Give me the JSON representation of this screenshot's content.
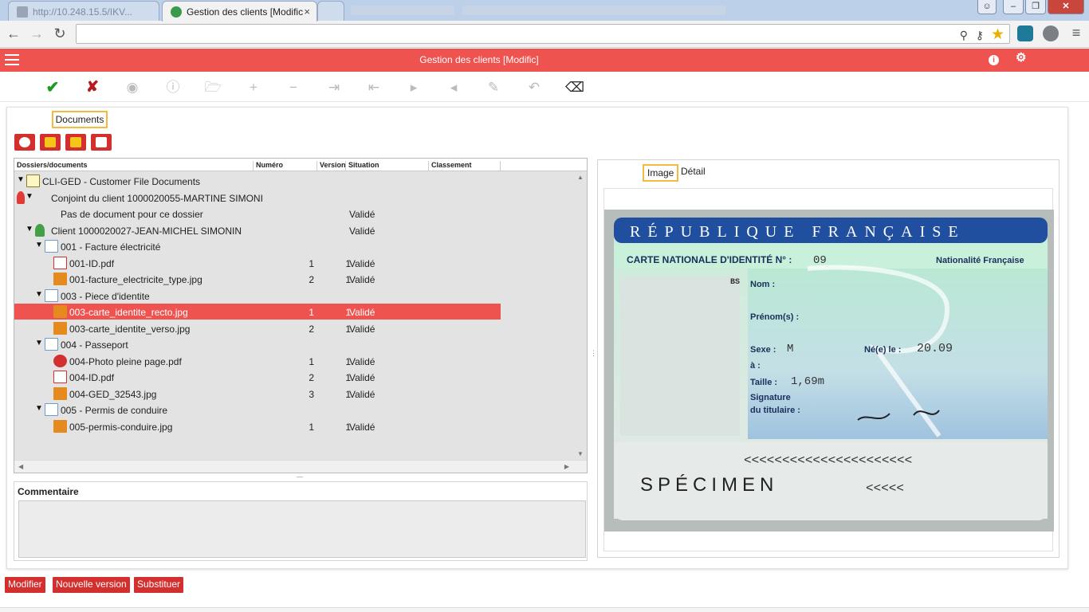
{
  "browser": {
    "tabs": [
      {
        "label": "http://10.248.15.5/IKV..."
      },
      {
        "label": "Gestion des clients [Modific"
      },
      {
        "label": ""
      }
    ],
    "window_controls": [
      "minimize",
      "maximize",
      "close"
    ]
  },
  "app": {
    "title": "Gestion des clients [Modific]",
    "accent_color": "#ef5350"
  },
  "toolbar": {
    "tools": [
      "check-icon",
      "cross-icon",
      "binoculars-icon",
      "info-icon",
      "folder-icon",
      "plus-icon",
      "minus-icon",
      "last-icon",
      "first-icon",
      "next-icon",
      "previous-icon",
      "pencil-icon",
      "undo-icon",
      "eraser-icon"
    ]
  },
  "documents_panel": {
    "tab_label": "Documents",
    "columns": [
      "Dossiers/documents",
      "Numéro",
      "Version",
      "Situation",
      "Classement"
    ],
    "rows": [
      {
        "level": 0,
        "toggle": "▼",
        "icon": "folder",
        "label": "CLI-GED - Customer File Documents",
        "num": "",
        "ver": "",
        "sit": ""
      },
      {
        "level": 1,
        "toggle": "▼",
        "icon": "person-red",
        "label": "Conjoint du client 1000020055-MARTINE SIMONI",
        "num": "",
        "ver": "",
        "sit": ""
      },
      {
        "level": 3,
        "toggle": "",
        "icon": "",
        "label": "Pas de document pour ce dossier",
        "num": "",
        "ver": "",
        "sit": "Validé"
      },
      {
        "level": 1,
        "toggle": "▼",
        "icon": "person-green",
        "label": "Client 1000020027-JEAN-MICHEL SIMONIN",
        "num": "",
        "ver": "",
        "sit": "Validé"
      },
      {
        "level": 2,
        "toggle": "▼",
        "icon": "doc-arrow",
        "label": "001 - Facture électricité",
        "num": "",
        "ver": "",
        "sit": ""
      },
      {
        "level": 3,
        "toggle": "",
        "icon": "pdf",
        "label": "001-ID.pdf",
        "num": "1",
        "ver": "1",
        "sit": "Validé"
      },
      {
        "level": 3,
        "toggle": "",
        "icon": "img",
        "label": "001-facture_electricite_type.jpg",
        "num": "2",
        "ver": "1",
        "sit": "Validé"
      },
      {
        "level": 2,
        "toggle": "▼",
        "icon": "doc-arrow",
        "label": "003 - Piece d'identite",
        "num": "",
        "ver": "",
        "sit": ""
      },
      {
        "level": 3,
        "toggle": "",
        "icon": "img",
        "label": "003-carte_identite_recto.jpg",
        "num": "1",
        "ver": "1",
        "sit": "Validé",
        "selected": true
      },
      {
        "level": 3,
        "toggle": "",
        "icon": "img",
        "label": "003-carte_identite_verso.jpg",
        "num": "2",
        "ver": "1",
        "sit": "Validé"
      },
      {
        "level": 2,
        "toggle": "▼",
        "icon": "doc-arrow",
        "label": "004 - Passeport",
        "num": "",
        "ver": "",
        "sit": ""
      },
      {
        "level": 3,
        "toggle": "",
        "icon": "error",
        "label": "004-Photo pleine page.pdf",
        "num": "1",
        "ver": "1",
        "sit": "Validé"
      },
      {
        "level": 3,
        "toggle": "",
        "icon": "pdf",
        "label": "004-ID.pdf",
        "num": "2",
        "ver": "1",
        "sit": "Validé"
      },
      {
        "level": 3,
        "toggle": "",
        "icon": "img",
        "label": "004-GED_32543.jpg",
        "num": "3",
        "ver": "1",
        "sit": "Validé"
      },
      {
        "level": 2,
        "toggle": "▼",
        "icon": "doc-arrow",
        "label": "005 - Permis de conduire",
        "num": "",
        "ver": "",
        "sit": ""
      },
      {
        "level": 3,
        "toggle": "",
        "icon": "img",
        "label": "005-permis-conduire.jpg",
        "num": "1",
        "ver": "1",
        "sit": "Validé"
      }
    ]
  },
  "comment": {
    "label": "Commentaire",
    "value": ""
  },
  "viewer": {
    "tabs": [
      "Image",
      "Détail"
    ],
    "id_card": {
      "header": "RÉPUBLIQUE FRANÇAISE",
      "card_title": "CARTE NATIONALE D'IDENTITÉ N° :",
      "card_number": "09",
      "nationality": "Nationalité Française",
      "bs": "BS",
      "field_nom": "Nom :",
      "field_prenom": "Prénom(s) :",
      "field_sexe": "Sexe :",
      "sexe_value": "M",
      "field_ne": "Né(e) le :",
      "ne_value": "20.09",
      "field_a": "à :",
      "field_taille": "Taille :",
      "taille_value": "1,69m",
      "field_signature": "Signature",
      "field_titulaire": "du titulaire :",
      "mrz1": "<<<<<<<<<<<<<<<<<<<<<<",
      "specimen": "SPÉCIMEN",
      "mrz2": "<<<<<"
    }
  },
  "footer": {
    "buttons": [
      "Modifier",
      "Nouvelle version",
      "Substituer"
    ]
  }
}
